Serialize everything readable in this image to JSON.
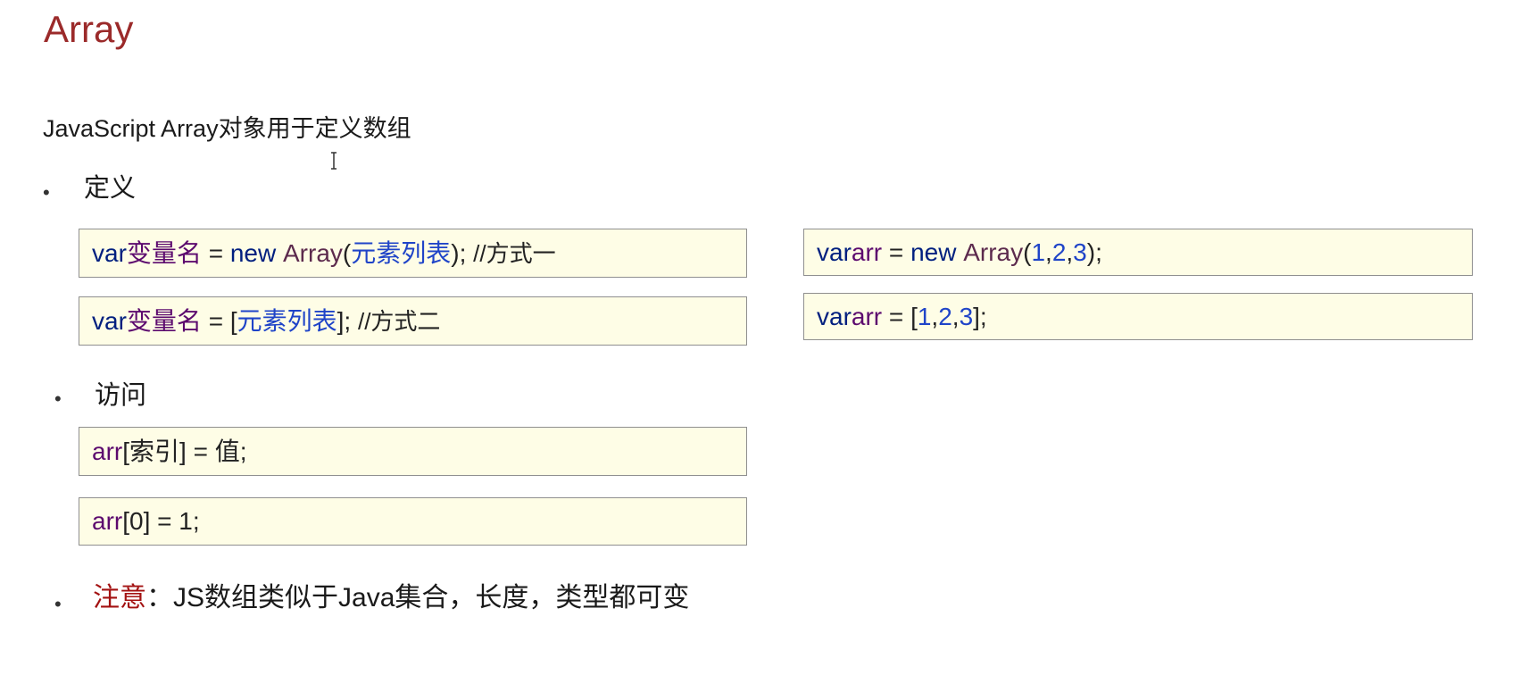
{
  "title": "Array",
  "intro": "JavaScript Array对象用于定义数组",
  "sections": {
    "define": {
      "label": "定义",
      "syntax_1": {
        "var": "var",
        "name": "变量名",
        "eq": " = ",
        "new": "new ",
        "ctor": "Array",
        "open": "(",
        "elems": "元素列表",
        "close": "); ",
        "comment": "//方式一"
      },
      "syntax_2": {
        "var": "var",
        "name": "变量名",
        "eq": " = ",
        "open": "[",
        "elems": "元素列表",
        "close": "]; ",
        "comment": "//方式二"
      },
      "example_1": {
        "var": "var",
        "name": "arr",
        "eq": " = ",
        "new": "new ",
        "ctor": "Array",
        "open": "(",
        "v1": "1",
        "c1": ",",
        "v2": "2",
        "c2": ",",
        "v3": "3",
        "close": ");"
      },
      "example_2": {
        "var": "var",
        "name": "arr",
        "eq": " = ",
        "open": "[",
        "v1": "1",
        "c1": ",",
        "v2": "2",
        "c2": ",",
        "v3": "3",
        "close": "];"
      }
    },
    "access": {
      "label": "访问",
      "syntax": {
        "name": "arr",
        "rest": "[索引] = 值;"
      },
      "example": {
        "name": "arr",
        "rest": "[0] = 1;"
      }
    },
    "note": {
      "label": "注意",
      "text": "：JS数组类似于Java集合，长度，类型都可变"
    }
  },
  "bullet_glyph": "•",
  "colors": {
    "title": "#9b2a2a",
    "keyword": "#001f7f",
    "identifier": "#5c0a6e",
    "value": "#1f44c8",
    "box_bg": "#fefde6",
    "note_red": "#a31212"
  },
  "icons": {
    "cursor": "text-ibeam-cursor-icon"
  }
}
